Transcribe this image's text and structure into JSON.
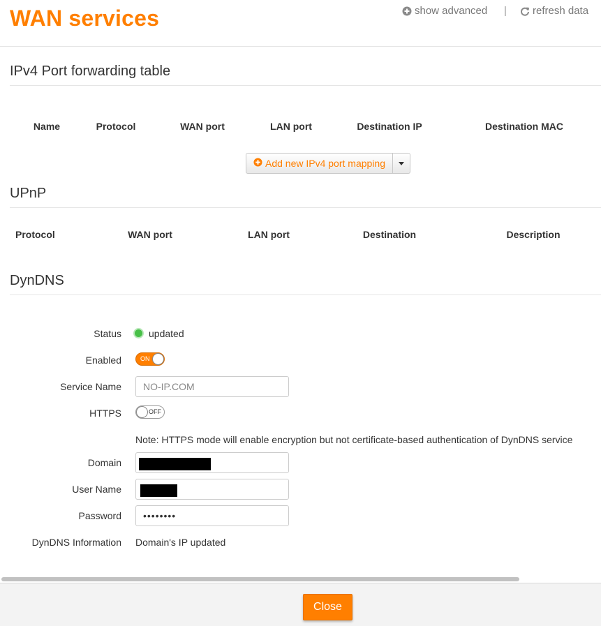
{
  "header": {
    "title": "WAN services",
    "show_advanced": "show advanced",
    "separator": "|",
    "refresh_data": "refresh data",
    "icons": {
      "show_advanced": "plus-circle-icon",
      "refresh_data": "refresh-icon"
    }
  },
  "ipv4": {
    "title": "IPv4 Port forwarding table",
    "columns": [
      "Name",
      "Protocol",
      "WAN port",
      "LAN port",
      "Destination IP",
      "Destination MAC"
    ],
    "add_button": "Add new IPv4 port mapping"
  },
  "upnp": {
    "title": "UPnP",
    "columns": [
      "Protocol",
      "WAN port",
      "LAN port",
      "Destination",
      "Description"
    ]
  },
  "dyndns": {
    "title": "DynDNS",
    "status_label": "Status",
    "status_value": "updated",
    "status_color": "#48c048",
    "enabled_label": "Enabled",
    "enabled_state": "ON",
    "service_label": "Service Name",
    "service_placeholder": "NO-IP.COM",
    "https_label": "HTTPS",
    "https_state": "OFF",
    "note": "Note: HTTPS mode will enable encryption but not certificate-based authentication of DynDNS service",
    "domain_label": "Domain",
    "username_label": "User Name",
    "password_label": "Password",
    "password_value": "••••••••",
    "info_label": "DynDNS Information",
    "info_value": "Domain's IP updated"
  },
  "footer": {
    "close": "Close"
  },
  "colors": {
    "accent": "#ff7f00"
  }
}
